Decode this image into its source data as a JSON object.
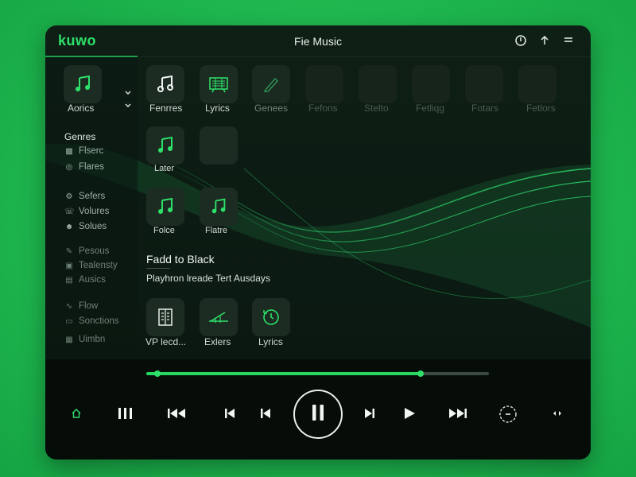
{
  "app": {
    "logo": "kuwo",
    "title": "Fie Music"
  },
  "sidebar": {
    "top_tile": {
      "label": "Aorics",
      "icon": "music-note-icon"
    },
    "sections": [
      {
        "heading": "Genres",
        "items": [
          {
            "label": "Flserc",
            "icon": "grid-icon"
          },
          {
            "label": "Flares",
            "icon": "disc-icon"
          }
        ]
      },
      {
        "heading": "",
        "items": [
          {
            "label": "Sefers",
            "icon": "settings-icon"
          },
          {
            "label": "Volures",
            "icon": "phone-icon"
          },
          {
            "label": "Solues",
            "icon": "user-icon"
          }
        ]
      },
      {
        "heading": "",
        "items": [
          {
            "label": "Pesous",
            "icon": "pen-icon"
          },
          {
            "label": "Tealensty",
            "icon": "tv-icon"
          },
          {
            "label": "Ausics",
            "icon": "bag-icon"
          }
        ]
      },
      {
        "heading": "",
        "items": [
          {
            "label": "Flow",
            "icon": "wave-icon"
          },
          {
            "label": "Sonctions",
            "icon": "doc-icon"
          },
          {
            "label": "Uimbn",
            "icon": "lock-icon"
          }
        ]
      }
    ]
  },
  "grid": {
    "row1": [
      {
        "label": "Fenrres",
        "icon": "note-outline-icon"
      },
      {
        "label": "Lyrics",
        "icon": "lyrics-board-icon"
      },
      {
        "label": "Genees",
        "icon": "pencil-icon"
      },
      {
        "label": "Fefons",
        "icon": ""
      },
      {
        "label": "Stelto",
        "icon": ""
      },
      {
        "label": "Fetliqg",
        "icon": ""
      },
      {
        "label": "Fotars",
        "icon": ""
      },
      {
        "label": "Fetlors",
        "icon": ""
      }
    ],
    "row2": [
      {
        "label": "Later",
        "icon": "music-note-icon"
      },
      {
        "label": "",
        "icon": ""
      }
    ],
    "row3": [
      {
        "label": "Folce",
        "icon": "music-note-icon"
      },
      {
        "label": "Flatre",
        "icon": "music-note-icon"
      }
    ],
    "row4": [
      {
        "label": "VP lecd...",
        "icon": "document-icon"
      },
      {
        "label": "Exlers",
        "icon": "equalizer-icon"
      },
      {
        "label": "Lyrics",
        "icon": "history-icon"
      }
    ]
  },
  "now_playing": {
    "title": "Fadd to Black",
    "subtitle": "Playhron lreade Tert Ausdays",
    "progress": 0.8
  },
  "colors": {
    "accent": "#2ee06a",
    "background": "#1fb84f",
    "window": "#0b1a12"
  }
}
